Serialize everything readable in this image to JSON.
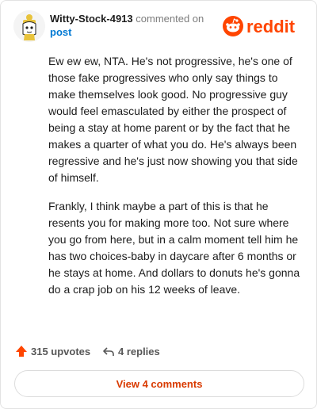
{
  "header": {
    "username": "Witty-Stock-4913",
    "commented_on": "commented on",
    "post_link": "post",
    "logo_text": "reddit"
  },
  "comment": {
    "paragraphs": [
      "Ew ew ew, NTA. He's not progressive, he's one of those fake progressives who only say things to make themselves look good. No progressive guy would feel emasculated by either the prospect of being a stay at home parent or by the fact that he makes a quarter of what you do. He's always been regressive and he's just now showing you that side of himself.",
      "Frankly, I think maybe a part of this is that he resents you for making more too. Not sure where you go from here, but in a calm moment tell him he has two choices-baby in daycare after 6 months or he stays at home. And dollars to donuts he's gonna do a crap job on his 12 weeks of leave."
    ]
  },
  "actions": {
    "upvotes": "315 upvotes",
    "replies": "4 replies"
  },
  "view_button": "View 4 comments",
  "colors": {
    "brand": "#ff4500",
    "link": "#0079d3",
    "view_text": "#d93a00"
  },
  "icons": [
    "avatar",
    "reddit-logo-icon",
    "upvote-arrow-icon",
    "reply-arrow-icon"
  ]
}
